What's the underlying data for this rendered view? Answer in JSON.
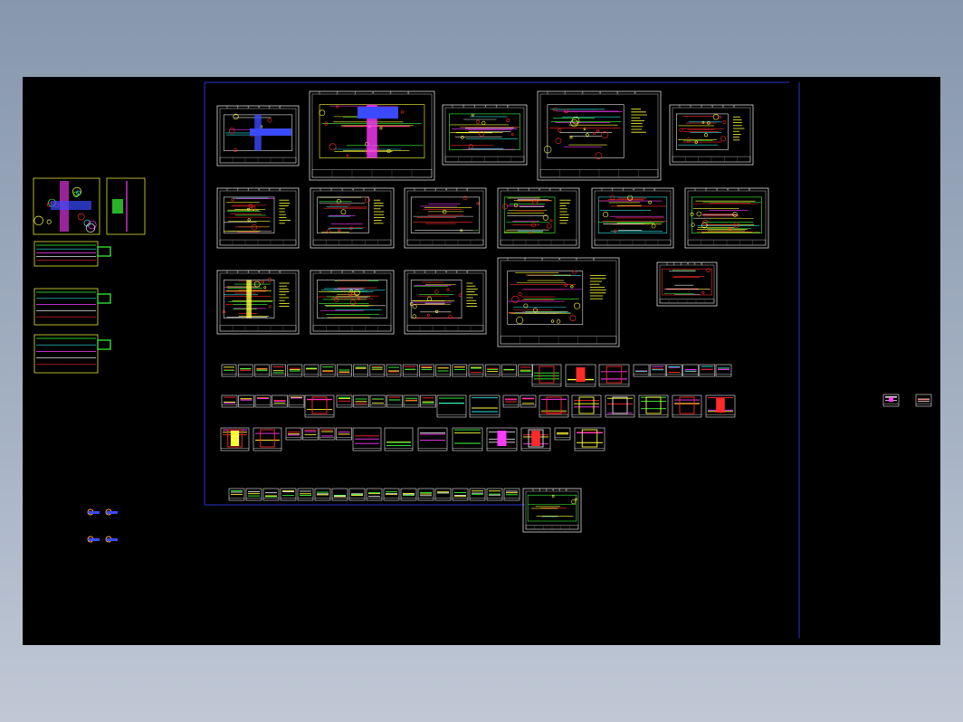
{
  "window": {
    "title": ""
  },
  "canvas": {
    "background": "#000000",
    "frame_color": "#2633d0"
  },
  "colors": {
    "red": "#ff2a2a",
    "yellow": "#ffff3a",
    "green": "#3aff3a",
    "cyan": "#2ee6e6",
    "magenta": "#ff3aff",
    "white": "#e6e6e6",
    "blue": "#3a4aff",
    "gray": "#8a8a8a",
    "orange": "#ffa640"
  },
  "border_numbers": [
    "1",
    "2",
    "3",
    "4",
    "5",
    "6"
  ]
}
